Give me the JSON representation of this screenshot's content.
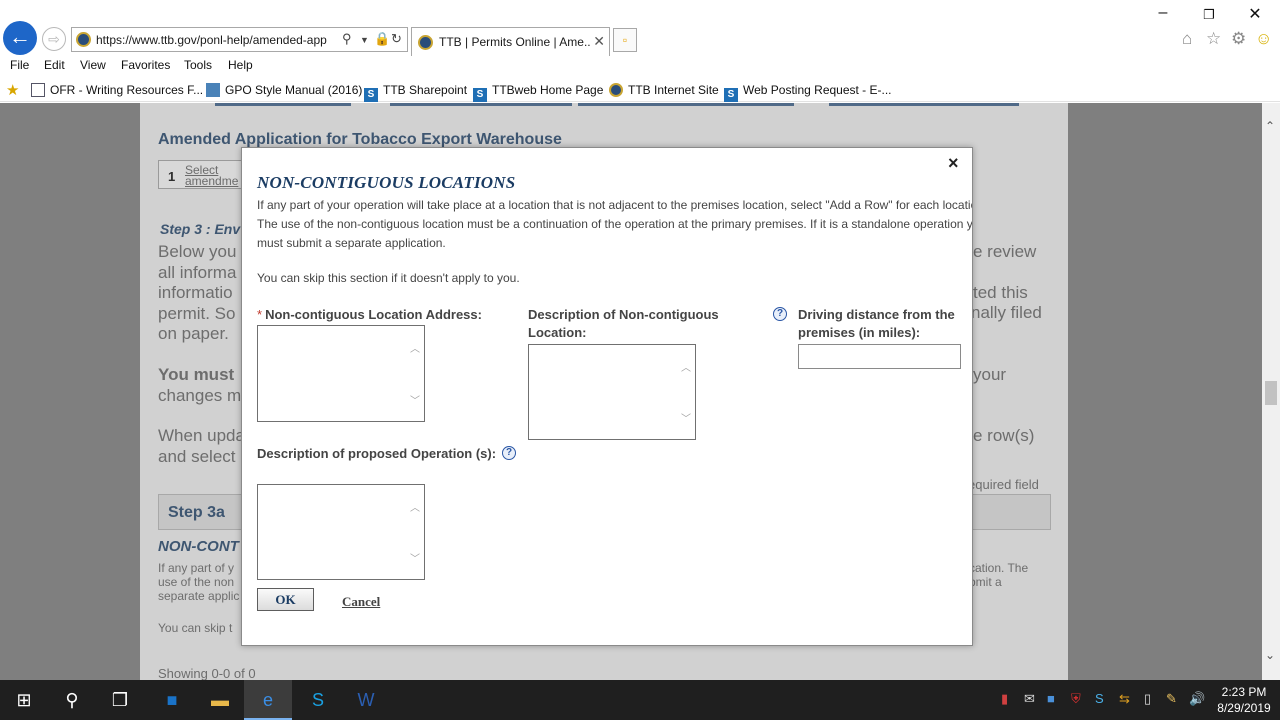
{
  "browser": {
    "url": "https://www.ttb.gov/ponl-help/amended-app",
    "tab_title": "TTB | Permits Online | Ame...",
    "menu": [
      "File",
      "Edit",
      "View",
      "Favorites",
      "Tools",
      "Help"
    ],
    "favorites": [
      "OFR - Writing Resources F...",
      "GPO Style Manual (2016)",
      "TTB Sharepoint",
      "TTBweb Home Page",
      "TTB Internet Site",
      "Web Posting Request - E-..."
    ]
  },
  "background": {
    "title": "Amended Application for Tobacco Export Warehouse",
    "step1_num": "1",
    "step1_label": "Select amendme",
    "step3_heading": "Step 3 : Env",
    "para1_lines": [
      "Below you",
      "all informa",
      "informatio",
      "permit. So",
      "on paper."
    ],
    "para1_right": [
      "e review",
      "ted this",
      "nally filed"
    ],
    "para2_lines": [
      "You must",
      "changes m"
    ],
    "para2_right": "your",
    "para3_lines": [
      "When upda",
      "and select"
    ],
    "para3_right": "e row(s)",
    "required_note": "equired field",
    "step3a": "Step 3a",
    "noncont": "NON-CONT",
    "small_lines": [
      "If any part of y",
      "use of the non",
      "separate applic"
    ],
    "small_right": [
      "cation. The",
      "bmit a"
    ],
    "skip_bg": "You can skip t",
    "showing": "Showing 0-0 of 0"
  },
  "modal": {
    "close": "×",
    "title": "NON-CONTIGUOUS LOCATIONS",
    "intro": "If any part of your operation will take place at a location that is not adjacent to the premises location, select \"Add a Row\" for each location. The use of the non-contiguous location must be a continuation of the operation at the primary premises. If it is a standalone operation you must submit a separate application.",
    "skip": "You can skip this section if it doesn't apply to you.",
    "required_mark": "*",
    "address_label": "Non-contiguous Location Address:",
    "description_label": "Description of Non-contiguous Location:",
    "distance_label": "Driving distance from the premises (in miles):",
    "operation_label": "Description of proposed Operation (s):",
    "help_glyph": "?",
    "ok": "OK",
    "cancel": "Cancel"
  },
  "taskbar": {
    "time": "2:23 PM",
    "date": "8/29/2019"
  }
}
